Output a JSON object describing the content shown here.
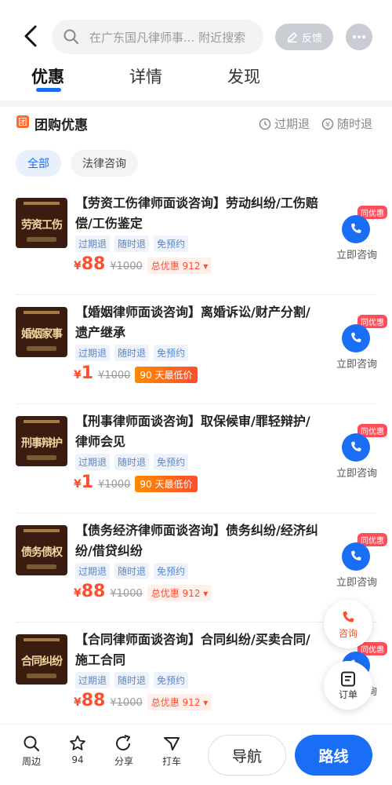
{
  "header": {
    "search_placeholder": "在广东国凡律师事... 附近搜索",
    "feedback_label": "反馈"
  },
  "tabs": [
    {
      "label": "优惠"
    },
    {
      "label": "详情"
    },
    {
      "label": "发现"
    }
  ],
  "group": {
    "icon_text": "团",
    "title": "团购优惠",
    "meta1": "过期退",
    "meta2": "随时退"
  },
  "filters": [
    {
      "label": "全部"
    },
    {
      "label": "法律咨询"
    }
  ],
  "items": [
    {
      "thumb_text": "劳资工伤",
      "title": "【劳资工伤律师面谈咨询】劳动纠纷/工伤赔偿/工伤鉴定",
      "tags": [
        "过期退",
        "随时退",
        "免预约"
      ],
      "price": "88",
      "currency": "¥",
      "orig": "¥1000",
      "badge": "总优惠 912 ▾",
      "badge_type": "discount",
      "consult_pill": "同优惠",
      "consult_label": "立即咨询"
    },
    {
      "thumb_text": "婚姻家事",
      "title": "【婚姻律师面谈咨询】离婚诉讼/财产分割/遗产继承",
      "tags": [
        "过期退",
        "随时退",
        "免预约"
      ],
      "price": "1",
      "currency": "¥",
      "orig": "¥1000",
      "badge": "90 天最低价",
      "badge_type": "lowest",
      "consult_pill": "同优惠",
      "consult_label": "立即咨询"
    },
    {
      "thumb_text": "刑事辩护",
      "title": "【刑事律师面谈咨询】取保候审/罪轻辩护/律师会见",
      "tags": [
        "过期退",
        "随时退",
        "免预约"
      ],
      "price": "1",
      "currency": "¥",
      "orig": "¥1000",
      "badge": "90 天最低价",
      "badge_type": "lowest",
      "consult_pill": "同优惠",
      "consult_label": "立即咨询"
    },
    {
      "thumb_text": "债务债权",
      "title": "【债务经济律师面谈咨询】债务纠纷/经济纠纷/借贷纠纷",
      "tags": [
        "过期退",
        "随时退",
        "免预约"
      ],
      "price": "88",
      "currency": "¥",
      "orig": "¥1000",
      "badge": "总优惠 912 ▾",
      "badge_type": "discount",
      "consult_pill": "同优惠",
      "consult_label": "立即咨询"
    },
    {
      "thumb_text": "合同纠纷",
      "title": "【合同律师面谈咨询】合同纠纷/买卖合同/施工合同",
      "tags": [
        "过期退",
        "随时退",
        "免预约"
      ],
      "price": "88",
      "currency": "¥",
      "orig": "¥1000",
      "badge": "总优惠 912 ▾",
      "badge_type": "discount",
      "consult_pill": "同优惠",
      "consult_label": "立即咨询"
    }
  ],
  "floating": {
    "consult_label": "咨询",
    "order_label": "订单"
  },
  "bottom": {
    "nearby": "周边",
    "favorite_count": "94",
    "share": "分享",
    "taxi": "打车",
    "navigate": "导航",
    "route": "路线"
  },
  "colors": {
    "accent": "#1a6ef5",
    "price": "#ff4d2d"
  }
}
